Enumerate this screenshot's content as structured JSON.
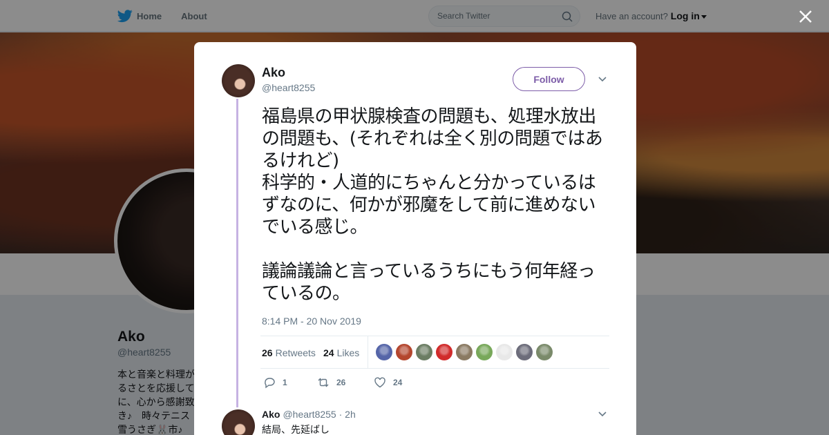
{
  "nav": {
    "home": "Home",
    "about": "About",
    "search_placeholder": "Search Twitter",
    "have_account": "Have an account?",
    "login": "Log in"
  },
  "profile": {
    "name": "Ako",
    "handle": "@heart8255",
    "bio": "本と音楽と料理が\nるさとを応援して\nに、心から感謝致\nき♪　時々テニス\n雪うさぎ🐰市♪"
  },
  "tweet": {
    "author_name": "Ako",
    "author_handle": "@heart8255",
    "follow_label": "Follow",
    "text": "福島県の甲状腺検査の問題も、処理水放出の問題も、(それぞれは全く別の問題ではあるけれど)\n科学的・人道的にちゃんと分かっているはずなのに、何かが邪魔をして前に進めないでいる感じ。\n\n議論議論と言っているうちにもう何年経っているの。",
    "timestamp": "8:14 PM - 20 Nov 2019",
    "retweets_count": "26",
    "retweets_label": "Retweets",
    "likes_count": "24",
    "likes_label": "Likes",
    "reply_count": "1",
    "retweet_count_action": "26",
    "like_count_action": "24",
    "liker_colors": [
      "#5565a8",
      "#b4462e",
      "#6b7d63",
      "#d12b2b",
      "#8a7a62",
      "#78a85a",
      "#e8e8e8",
      "#6c6c7a",
      "#7a8a6a"
    ]
  },
  "reply": {
    "name": "Ako",
    "handle": "@heart8255",
    "time": "· 2h",
    "text": "結局、先延ばし"
  },
  "colors": {
    "twitter_blue": "#1da1f2",
    "accent_purple": "#7c5ca8",
    "thread_line": "#c6b2e2"
  }
}
